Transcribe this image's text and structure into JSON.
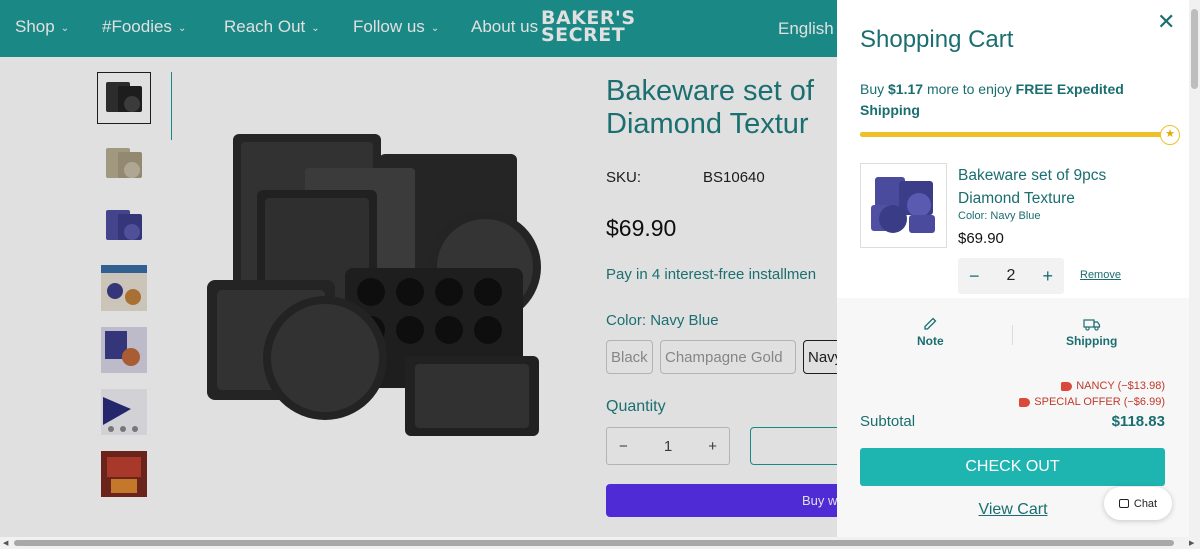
{
  "header": {
    "nav": [
      {
        "label": "Shop",
        "has_dropdown": true
      },
      {
        "label": "#Foodies",
        "has_dropdown": true
      },
      {
        "label": "Reach Out",
        "has_dropdown": true
      },
      {
        "label": "Follow us",
        "has_dropdown": true
      },
      {
        "label": "About us",
        "has_dropdown": false
      }
    ],
    "logo_line1": "BAKER'S",
    "logo_line2": "SECRET",
    "language": "English",
    "background_color": "#1e9c99"
  },
  "product": {
    "title_line1": "Bakeware set of",
    "title_line2": "Diamond Textur",
    "sku_label": "SKU:",
    "sku_value": "BS10640",
    "price": "$69.90",
    "installments": "Pay in 4 interest-free installmen",
    "color_label": "Color:",
    "color_value": "Navy Blue",
    "swatches": [
      "Black",
      "Champagne Gold",
      "Navy"
    ],
    "quantity_label": "Quantity",
    "quantity_minus": "−",
    "quantity_value": "1",
    "quantity_plus": "+",
    "buy_label": "Buy w",
    "thumbnail_count": 7
  },
  "cart": {
    "title": "Shopping Cart",
    "close_icon": "close-icon",
    "shipping_msg_prefix": "Buy ",
    "shipping_amount": "$1.17",
    "shipping_msg_mid": " more to enjoy ",
    "shipping_reward": "FREE Expedited Shipping",
    "progress_fraction": 0.98,
    "accent_color": "#f0c02a",
    "item": {
      "name": "Bakeware set of 9pcs Diamond Texture",
      "variant_label": "Color:",
      "variant_value": "Navy Blue",
      "price": "$69.90",
      "qty_minus": "−",
      "quantity": "2",
      "qty_plus": "+",
      "remove": "Remove"
    },
    "tools": [
      {
        "label": "Note",
        "icon": "pencil-icon"
      },
      {
        "label": "Shipping",
        "icon": "truck-icon"
      }
    ],
    "discounts": [
      {
        "label": "NANCY (−$13.98)"
      },
      {
        "label": "SPECIAL OFFER (−$6.99)"
      }
    ],
    "subtotal_label": "Subtotal",
    "subtotal_value": "$118.83",
    "checkout_label": "CHECK OUT",
    "view_cart_label": "View Cart",
    "button_color": "#1eb5b0"
  },
  "chat": {
    "label": "Chat"
  }
}
